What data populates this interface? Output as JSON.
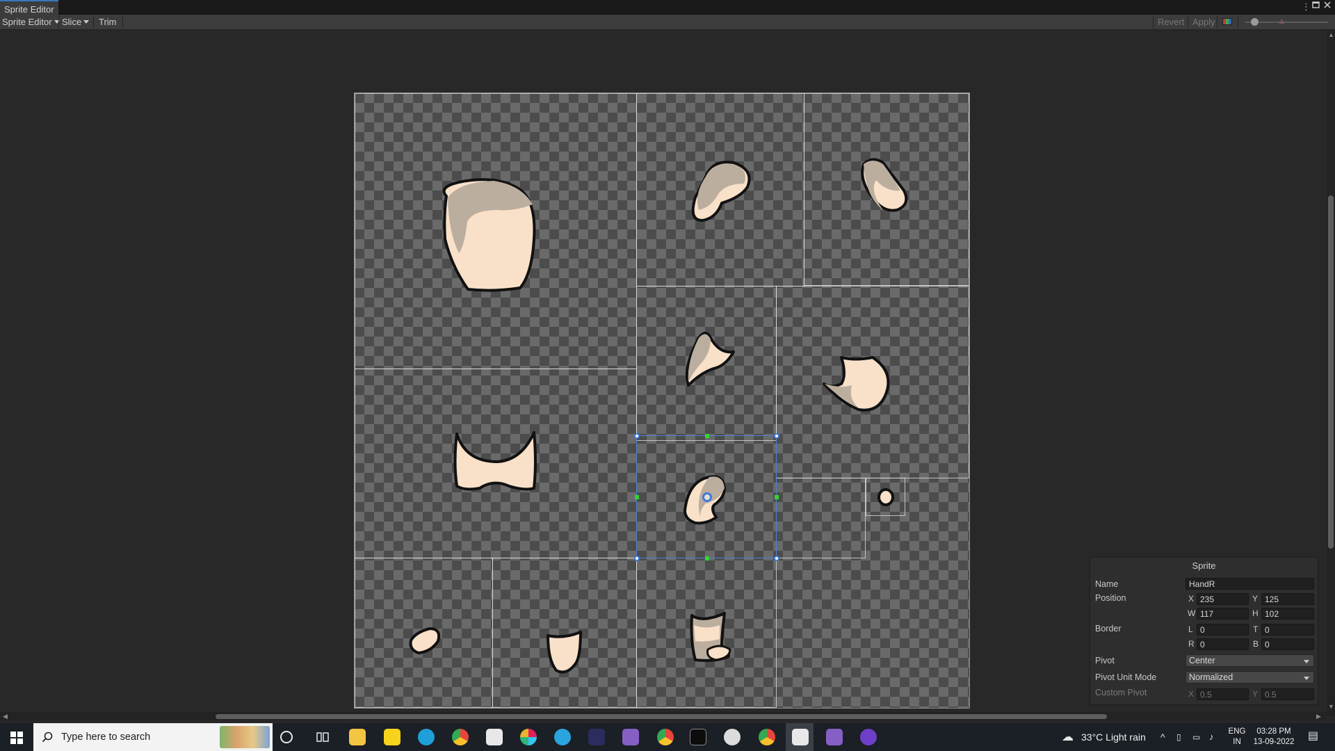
{
  "window": {
    "tab_title": "Sprite Editor",
    "menu_icon": "kebab-icon",
    "maximize_icon": "maximize-icon",
    "close_icon": "close-icon"
  },
  "toolbar": {
    "editor_mode": "Sprite Editor",
    "slice_label": "Slice",
    "trim_label": "Trim",
    "revert_label": "Revert",
    "apply_label": "Apply",
    "zoom_level": 0.1
  },
  "sprite_panel": {
    "title": "Sprite",
    "name_label": "Name",
    "name_value": "HandR",
    "position_label": "Position",
    "x_label": "X",
    "x_value": "235",
    "y_label": "Y",
    "y_value": "125",
    "w_label": "W",
    "w_value": "117",
    "h_label": "H",
    "h_value": "102",
    "border_label": "Border",
    "l_label": "L",
    "l_value": "0",
    "t_label": "T",
    "t_value": "0",
    "r_label": "R",
    "r_value": "0",
    "b_label": "B",
    "b_value": "0",
    "pivot_label": "Pivot",
    "pivot_value": "Center",
    "pivot_unit_label": "Pivot Unit Mode",
    "pivot_unit_value": "Normalized",
    "custom_pivot_label": "Custom Pivot",
    "cx_label": "X",
    "cx_value": "0.5",
    "cy_label": "Y",
    "cy_value": "0.5"
  },
  "taskbar": {
    "search_placeholder": "Type here to search",
    "weather": "33°C  Light rain",
    "language_top": "ENG",
    "language_bottom": "IN",
    "time": "03:28 PM",
    "date": "13-09-2022",
    "apps": [
      "cortana-icon",
      "task-view-icon",
      "file-explorer-icon",
      "sticky-notes-icon",
      "edge-icon",
      "chrome-icon",
      "unity-hub-icon",
      "slack-icon",
      "telegram-icon",
      "fox-icon",
      "visual-studio-icon",
      "chrome-profile-icon",
      "terminal-icon",
      "unity-icon",
      "chrome-alt-icon",
      "unity-active-icon",
      "visual-studio-alt-icon",
      "github-desktop-icon"
    ]
  },
  "colors": {
    "accent": "#3f7ad8",
    "handle_green": "#35d435",
    "skin": "#f9e0c8",
    "skin_shadow": "#bcae9f"
  }
}
